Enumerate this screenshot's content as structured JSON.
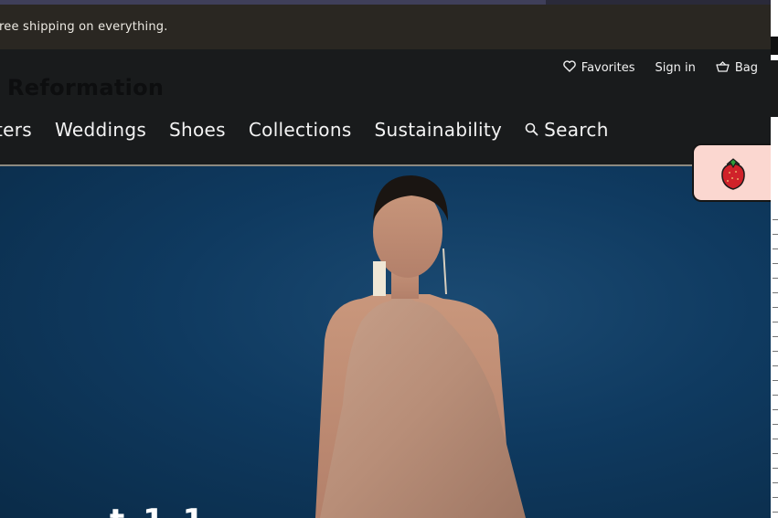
{
  "promo": {
    "text": "ree shipping on everything."
  },
  "header": {
    "utility": [
      {
        "label": "Favorites",
        "icon": "heart-icon"
      },
      {
        "label": "Sign in"
      },
      {
        "label": "Bag",
        "icon": "bag-icon"
      }
    ],
    "logo": "Reformation",
    "nav": [
      "ters",
      "Weddings",
      "Shoes",
      "Collections",
      "Sustainability"
    ],
    "search_label": "Search"
  },
  "hero": {
    "partial_text": "t     1 1"
  },
  "widget": {
    "icon": "strawberry-icon"
  },
  "colors": {
    "promo_bg": "#2a2722",
    "header_bg": "#191b1c",
    "hero_bg": "#0f3a60",
    "widget_bg": "#fbd7d0"
  }
}
